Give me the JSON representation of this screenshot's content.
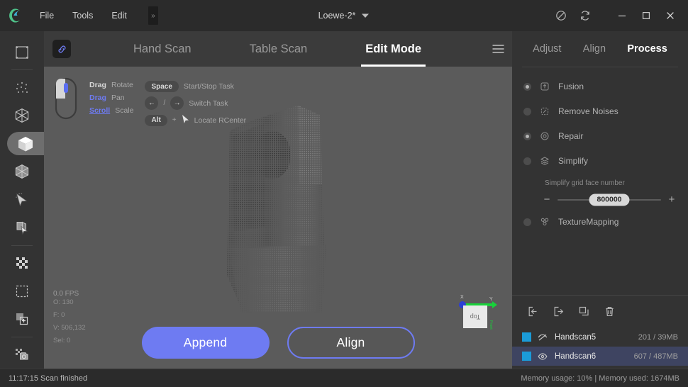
{
  "titlebar": {
    "logo": "app-logo-c",
    "menus": [
      "File",
      "Tools",
      "Edit"
    ],
    "expander": "»",
    "project_name": "Loewe-2*",
    "caret": "chevron-down-icon",
    "buttons": [
      {
        "name": "no-record-icon",
        "label": "⊘"
      },
      {
        "name": "sync-icon",
        "label": "↻"
      }
    ],
    "window_controls": [
      {
        "name": "minimize-button",
        "label": "—"
      },
      {
        "name": "maximize-button",
        "label": "□"
      },
      {
        "name": "close-button",
        "label": "✕"
      }
    ]
  },
  "rail": {
    "items": [
      {
        "name": "frame-crop-icon",
        "active": false
      },
      {
        "name": "point-cloud-icon",
        "active": false
      },
      {
        "name": "wireframe-cube-icon",
        "active": false
      },
      {
        "name": "solid-cube-icon",
        "active": true
      },
      {
        "name": "shaded-cube-icon",
        "active": false
      },
      {
        "name": "select-cursor-icon",
        "active": false
      },
      {
        "name": "layer-select-icon",
        "active": false
      },
      {
        "name": "checkerboard-icon",
        "active": false
      },
      {
        "name": "marquee-select-icon",
        "active": false
      },
      {
        "name": "add-layer-icon",
        "active": false
      },
      {
        "name": "snapshot-icon",
        "active": false
      }
    ]
  },
  "tabbar": {
    "link_chip": "link-icon",
    "tabs": [
      {
        "label": "Hand Scan",
        "active": false
      },
      {
        "label": "Table Scan",
        "active": false
      },
      {
        "label": "Edit Mode",
        "active": true
      }
    ],
    "menu_icon": "hamburger-icon"
  },
  "viewport": {
    "hints": {
      "mouse_icon": "mouse-icon",
      "mouse_rows": [
        {
          "key": "Drag",
          "action": "Rotate",
          "style": "plain"
        },
        {
          "key": "Drag",
          "action": "Pan",
          "style": "blue"
        },
        {
          "key": "Scroll",
          "action": "Scale",
          "style": "blue-underline"
        }
      ],
      "key_rows": [
        {
          "keys": [
            "Space"
          ],
          "action": "Start/Stop Task",
          "type": "pill"
        },
        {
          "keys": [
            "←",
            "→"
          ],
          "action": "Switch Task",
          "type": "round-pair"
        },
        {
          "keys": [
            "Alt"
          ],
          "action": "Locate RCenter",
          "type": "pill-plus-cursor"
        }
      ]
    },
    "fps": "0.0 FPS",
    "stats": [
      "O: 130",
      "F: 0",
      "V: 506,132",
      "Sel: 0"
    ],
    "buttons": {
      "append": "Append",
      "align": "Align"
    },
    "gizmo": {
      "face_label": "Top",
      "axes": [
        {
          "name": "x-axis",
          "label": "X",
          "color": "#2b3fd6"
        },
        {
          "name": "y-axis",
          "label": "Y",
          "color": "#18d13a"
        }
      ]
    },
    "colors": {
      "accent": "#6e7bf2",
      "background": "#5b5b5b"
    }
  },
  "right_panel": {
    "tabs": [
      {
        "label": "Adjust",
        "active": false
      },
      {
        "label": "Align",
        "active": false
      },
      {
        "label": "Process",
        "active": true
      }
    ],
    "process_items": [
      {
        "label": "Fusion",
        "icon": "fusion-icon",
        "selected": true
      },
      {
        "label": "Remove Noises",
        "icon": "remove-noises-icon",
        "selected": false
      },
      {
        "label": "Repair",
        "icon": "repair-icon",
        "selected": true
      },
      {
        "label": "Simplify",
        "icon": "simplify-icon",
        "selected": false
      }
    ],
    "slider": {
      "label": "Simplify grid face number",
      "value": "800000",
      "minus": "−",
      "plus": "+"
    },
    "texture_item": {
      "label": "TextureMapping",
      "icon": "texture-mapping-icon",
      "selected": false
    },
    "file_tools": [
      {
        "name": "import-button",
        "label": "import-icon"
      },
      {
        "name": "export-button",
        "label": "export-icon"
      },
      {
        "name": "duplicate-button",
        "label": "duplicate-icon"
      },
      {
        "name": "delete-button",
        "label": "trash-icon"
      }
    ],
    "files": [
      {
        "name": "Handscan5",
        "size": "201 / 39MB",
        "selected": false,
        "visible": false,
        "swatch": "#1b9bd8"
      },
      {
        "name": "Handscan6",
        "size": "607 / 487MB",
        "selected": true,
        "visible": true,
        "swatch": "#1b9bd8"
      }
    ]
  },
  "status_bar": {
    "left": "11:17:15 Scan finished",
    "right": "Memory usage: 10% | Memory used: 1674MB"
  }
}
